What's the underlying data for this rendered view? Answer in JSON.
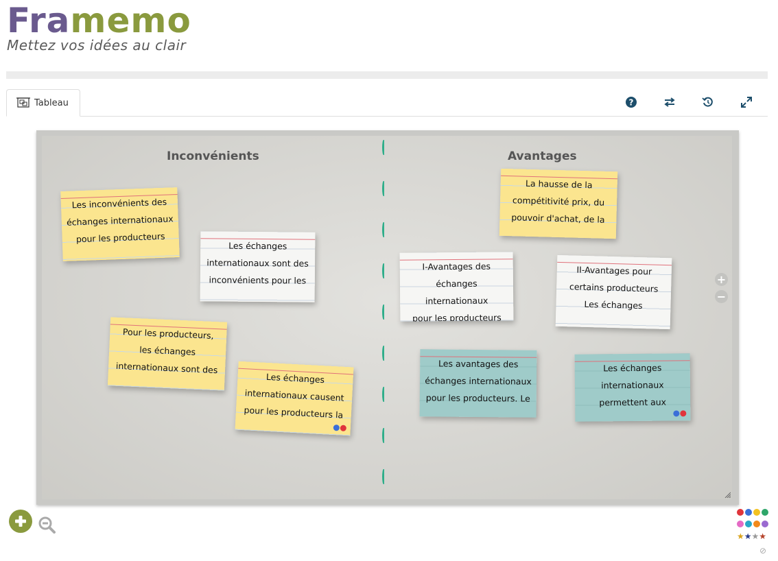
{
  "app": {
    "brand_part1": "Fra",
    "brand_part2": "memo",
    "tagline": "Mettez vos idées au clair"
  },
  "tabs": [
    {
      "label": "Tableau"
    }
  ],
  "toolbar": {
    "icons": [
      "help-icon",
      "swap-icon",
      "history-icon",
      "fullscreen-icon"
    ]
  },
  "board": {
    "columns": [
      {
        "title": "Inconvénients"
      },
      {
        "title": "Avantages"
      }
    ],
    "cards": [
      {
        "text": "Les inconvénients des\néchanges internationaux\npour les producteurs",
        "color": "yellow"
      },
      {
        "text": "Les échanges\ninternationaux sont des\ninconvénients pour les",
        "color": "white"
      },
      {
        "text": "Pour les producteurs,\nles échanges\ninternationaux sont des",
        "color": "yellow"
      },
      {
        "text": "Les échanges\ninternationaux causent\npour les producteurs la",
        "color": "yellow"
      },
      {
        "text": "La hausse de la\ncompétitivité prix, du\npouvoir d'achat, de la",
        "color": "yellow"
      },
      {
        "text": "I-Avantages des\néchanges internationaux\npour les producteurs",
        "color": "white"
      },
      {
        "text": "II-Avantages pour\ncertains producteurs\nLes échanges",
        "color": "white"
      },
      {
        "text": "Les avantages des\néchanges internationaux\npour les producteurs. Le",
        "color": "teal"
      },
      {
        "text": "Les échanges\ninternationaux\npermettent aux",
        "color": "teal"
      }
    ]
  },
  "colors": {
    "brand_purple": "#6a5a8e",
    "brand_green": "#8a9a3e",
    "toolbar_icon": "#1d4e6b",
    "divider": "#2fae8a"
  },
  "palette": {
    "colors": [
      "#e0353b",
      "#3a6fd8",
      "#f3c221",
      "#2ea66a",
      "#e46ac5",
      "#29a8c8",
      "#f28a1c",
      "#9a6ad0"
    ],
    "stars": [
      "#d9a21a",
      "#2c3e8a",
      "#999999",
      "#b5422a"
    ]
  }
}
